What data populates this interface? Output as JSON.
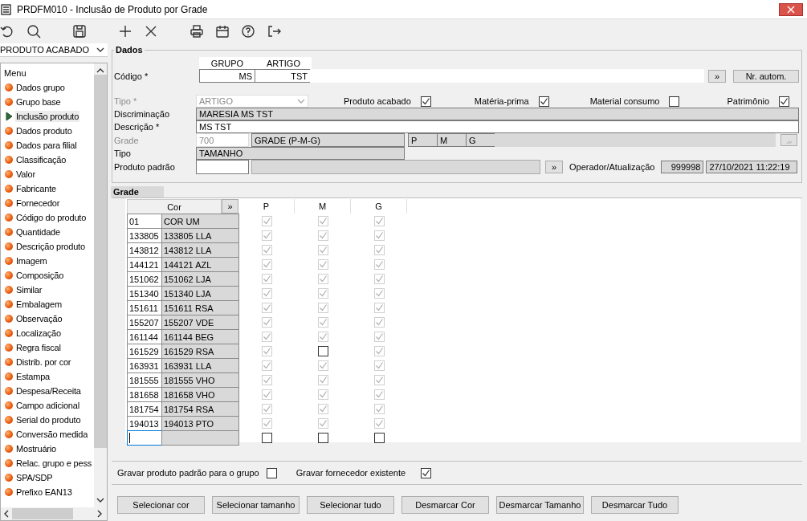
{
  "window": {
    "title": "PRDFM010 - Inclusão de Produto por Grade"
  },
  "sidebar": {
    "category": "PRODUTO ACABADO",
    "menu_title": "Menu",
    "items": [
      {
        "label": "Dados grupo",
        "selected": false
      },
      {
        "label": "Grupo base",
        "selected": false
      },
      {
        "label": "Inclusão produto",
        "selected": true
      },
      {
        "label": "Dados produto",
        "selected": false
      },
      {
        "label": "Dados para filial",
        "selected": false
      },
      {
        "label": "Classificação",
        "selected": false
      },
      {
        "label": "Valor",
        "selected": false
      },
      {
        "label": "Fabricante",
        "selected": false
      },
      {
        "label": "Fornecedor",
        "selected": false
      },
      {
        "label": "Código do produto",
        "selected": false
      },
      {
        "label": "Quantidade",
        "selected": false
      },
      {
        "label": "Descrição produto",
        "selected": false
      },
      {
        "label": "Imagem",
        "selected": false
      },
      {
        "label": "Composição",
        "selected": false
      },
      {
        "label": "Similar",
        "selected": false
      },
      {
        "label": "Embalagem",
        "selected": false
      },
      {
        "label": "Observação",
        "selected": false
      },
      {
        "label": "Localização",
        "selected": false
      },
      {
        "label": "Regra fiscal",
        "selected": false
      },
      {
        "label": "Distrib. por cor",
        "selected": false
      },
      {
        "label": "Estampa",
        "selected": false
      },
      {
        "label": "Despesa/Receita",
        "selected": false
      },
      {
        "label": "Campo adicional",
        "selected": false
      },
      {
        "label": "Serial do produto",
        "selected": false
      },
      {
        "label": "Conversão medida",
        "selected": false
      },
      {
        "label": "Mostruário",
        "selected": false
      },
      {
        "label": "Relac. grupo e pess",
        "selected": false
      },
      {
        "label": "SPA/SDP",
        "selected": false
      },
      {
        "label": "Prefixo EAN13",
        "selected": false
      }
    ]
  },
  "dados": {
    "title": "Dados",
    "codigo": {
      "label": "Código *",
      "disabled": false,
      "columns": [
        "GRUPO",
        "ARTIGO"
      ],
      "values": [
        "MS",
        "TST"
      ],
      "more_button": "»",
      "auto_button": "Nr. autom."
    },
    "tipo": {
      "label": "Tipo *",
      "disabled": true,
      "value": "ARTIGO"
    },
    "flags": [
      {
        "label": "Produto acabado",
        "checked": true
      },
      {
        "label": "Matéria-prima",
        "checked": true
      },
      {
        "label": "Material consumo",
        "checked": false
      },
      {
        "label": "Patrimônio",
        "checked": true
      }
    ],
    "discriminacao": {
      "label": "Discriminação",
      "disabled": false,
      "value": "MARESIA MS TST"
    },
    "descricao": {
      "label": "Descrição *",
      "disabled": false,
      "value": "MS TST"
    },
    "grade": {
      "label": "Grade",
      "disabled": true,
      "code": "700",
      "name": "GRADE (P-M-G)",
      "sizes": [
        "P",
        "M",
        "G"
      ]
    },
    "tipo_grade": {
      "label": "Tipo",
      "disabled": false,
      "value": "TAMANHO"
    },
    "produto_padrao": {
      "label": "Produto padrão",
      "disabled": false,
      "more_button": "»"
    },
    "operador": {
      "label": "Operador/Atualização",
      "user": "999998",
      "timestamp": "27/10/2021 11:22:19"
    }
  },
  "grade": {
    "title": "Grade",
    "cor_header": "Cor",
    "more_button": "»",
    "sizes": [
      "P",
      "M",
      "G"
    ],
    "rows": [
      {
        "code": "01",
        "name": "COR UM",
        "cells": [
          {
            "checked": true
          },
          {
            "checked": true
          },
          {
            "checked": true
          }
        ]
      },
      {
        "code": "133805",
        "name": "133805 LLA",
        "cells": [
          {
            "checked": true
          },
          {
            "checked": true
          },
          {
            "checked": true
          }
        ]
      },
      {
        "code": "143812",
        "name": "143812 LLA",
        "cells": [
          {
            "checked": true
          },
          {
            "checked": true
          },
          {
            "checked": true
          }
        ]
      },
      {
        "code": "144121",
        "name": "144121 AZL",
        "cells": [
          {
            "checked": true
          },
          {
            "checked": true
          },
          {
            "checked": true
          }
        ]
      },
      {
        "code": "151062",
        "name": "151062 LJA",
        "cells": [
          {
            "checked": true
          },
          {
            "checked": true
          },
          {
            "checked": true
          }
        ]
      },
      {
        "code": "151340",
        "name": "151340 LJA",
        "cells": [
          {
            "checked": true
          },
          {
            "checked": true
          },
          {
            "checked": true
          }
        ]
      },
      {
        "code": "151611",
        "name": "151611 RSA",
        "cells": [
          {
            "checked": true
          },
          {
            "checked": true
          },
          {
            "checked": true
          }
        ]
      },
      {
        "code": "155207",
        "name": "155207 VDE",
        "cells": [
          {
            "checked": true
          },
          {
            "checked": true
          },
          {
            "checked": true
          }
        ]
      },
      {
        "code": "161144",
        "name": "161144 BEG",
        "cells": [
          {
            "checked": true
          },
          {
            "checked": true
          },
          {
            "checked": true
          }
        ]
      },
      {
        "code": "161529",
        "name": "161529 RSA",
        "cells": [
          {
            "checked": true
          },
          {
            "checked": false
          },
          {
            "checked": true
          }
        ]
      },
      {
        "code": "163931",
        "name": "163931 LLA",
        "cells": [
          {
            "checked": true
          },
          {
            "checked": true
          },
          {
            "checked": true
          }
        ]
      },
      {
        "code": "181555",
        "name": "181555 VHO",
        "cells": [
          {
            "checked": true
          },
          {
            "checked": true
          },
          {
            "checked": true
          }
        ]
      },
      {
        "code": "181658",
        "name": "181658 VHO",
        "cells": [
          {
            "checked": true
          },
          {
            "checked": true
          },
          {
            "checked": true
          }
        ]
      },
      {
        "code": "181754",
        "name": "181754 RSA",
        "cells": [
          {
            "checked": true
          },
          {
            "checked": true
          },
          {
            "checked": true
          }
        ]
      },
      {
        "code": "194013",
        "name": "194013 PTO",
        "cells": [
          {
            "checked": true
          },
          {
            "checked": true
          },
          {
            "checked": true
          }
        ]
      }
    ],
    "new_row": {
      "cells": [
        {
          "checked": false
        },
        {
          "checked": false
        },
        {
          "checked": false
        }
      ]
    }
  },
  "options": [
    {
      "label": "Gravar produto padrão para o grupo",
      "checked": false
    },
    {
      "label": "Gravar fornecedor existente",
      "checked": true
    }
  ],
  "buttons": [
    "Selecionar cor",
    "Selecionar tamanho",
    "Selecionar tudo",
    "Desmarcar Cor",
    "Desmarcar Tamanho",
    "Desmarcar Tudo"
  ]
}
